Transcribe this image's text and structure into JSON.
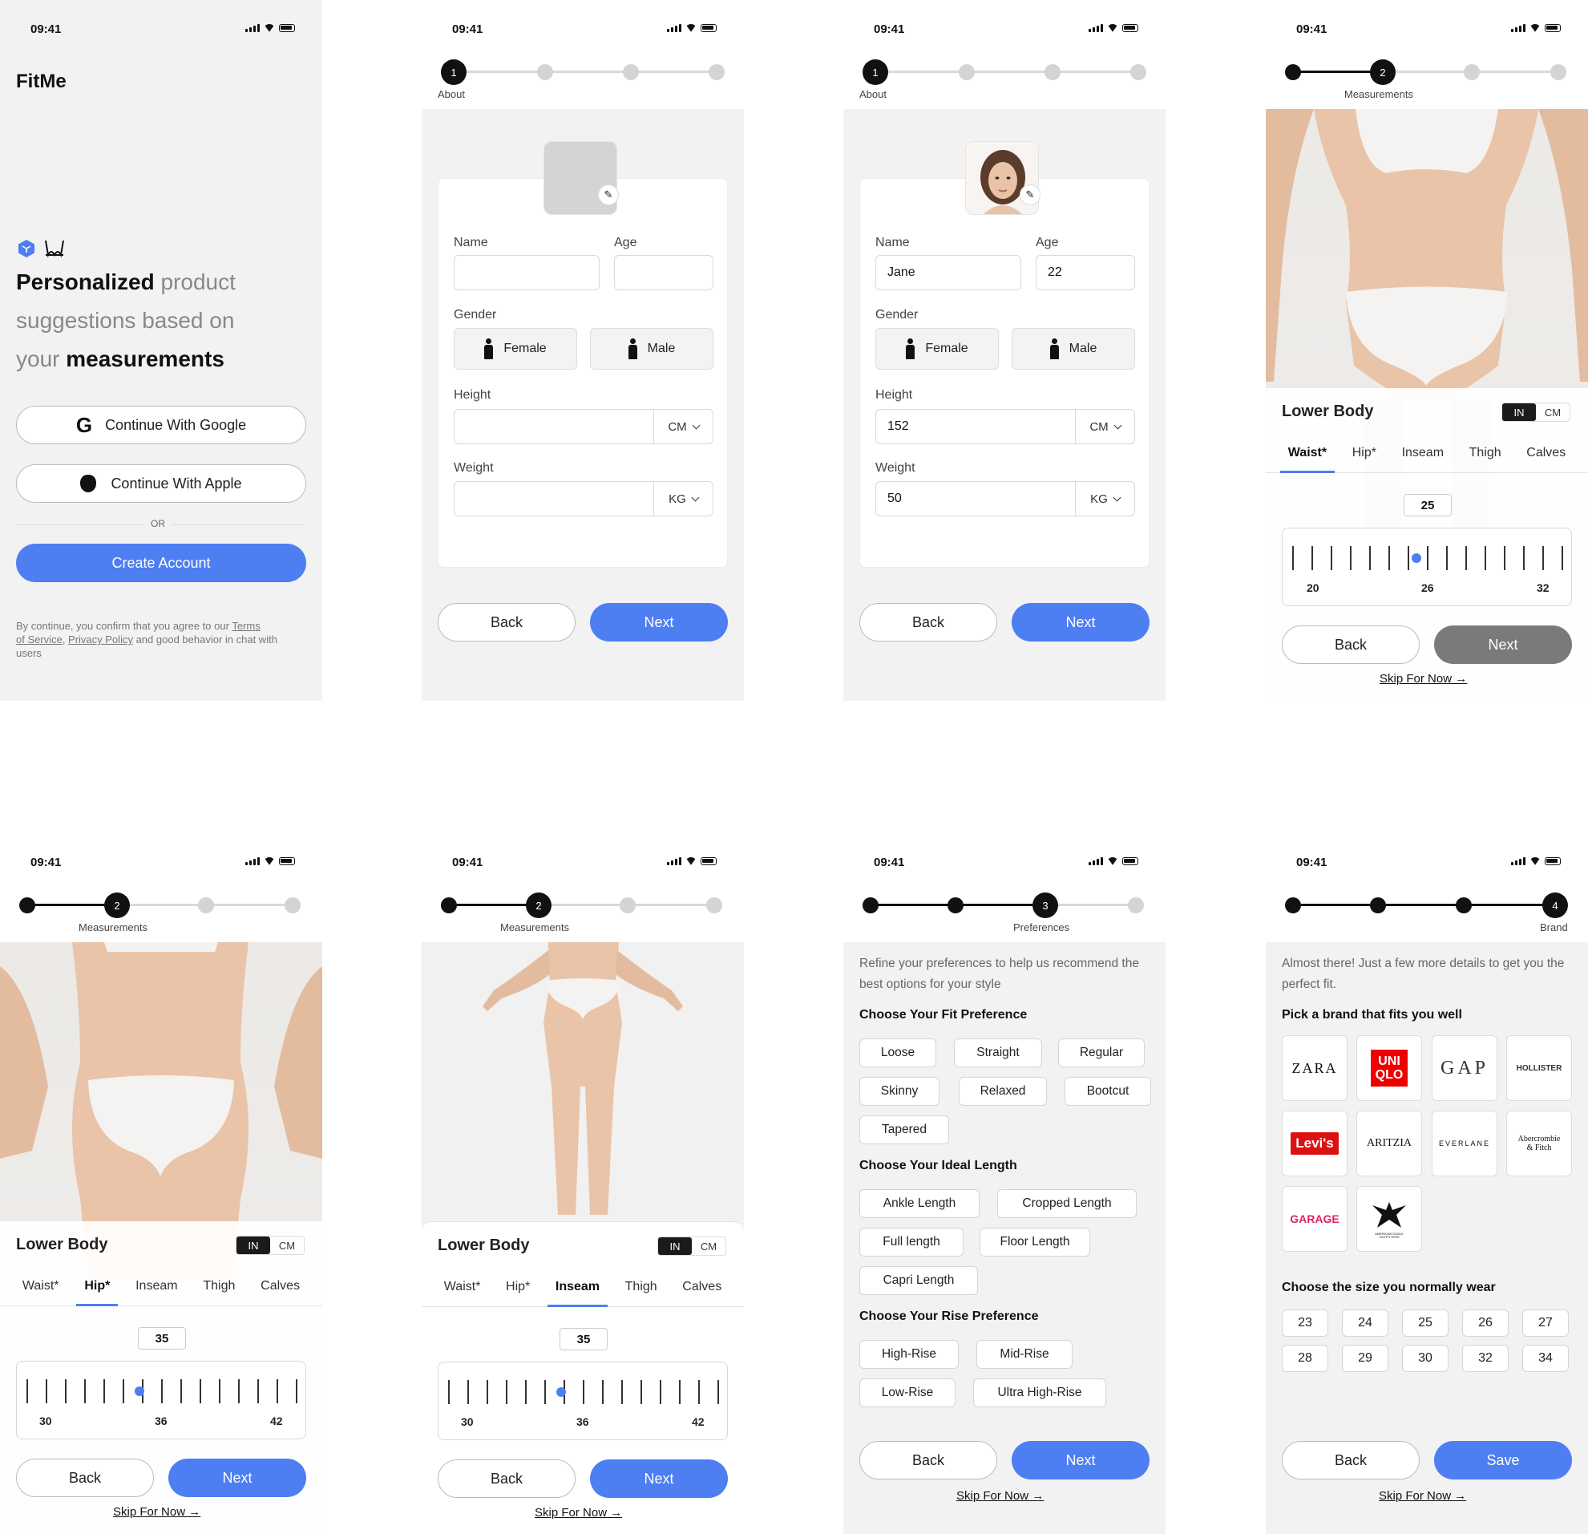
{
  "status_time": "09:41",
  "s1": {
    "app_name": "FitMe",
    "headline_a": "Personalized",
    "headline_b": " product",
    "headline_c": "suggestions based on",
    "headline_d": "your ",
    "headline_e": "measurements",
    "google_label": "Continue With Google",
    "apple_label": "Continue With Apple",
    "or_label": "OR",
    "create_label": "Create Account",
    "legal_a": "By continue, you confirm that you agree to our ",
    "legal_terms_1": "Terms",
    "legal_terms_2": "of Service",
    "legal_b": ", ",
    "legal_privacy": "Privacy Policy",
    "legal_c": " and good behavior in chat with users"
  },
  "about": {
    "step_label": "About",
    "step_num": "1",
    "name_label": "Name",
    "age_label": "Age",
    "gender_label": "Gender",
    "female_label": "Female",
    "male_label": "Male",
    "height_label": "Height",
    "weight_label": "Weight",
    "height_unit": "CM",
    "weight_unit": "KG",
    "filled": {
      "name": "Jane",
      "age": "22",
      "height": "152",
      "weight": "50"
    }
  },
  "buttons": {
    "back": "Back",
    "next": "Next",
    "save": "Save",
    "skip": "Skip For Now →"
  },
  "measure": {
    "step_label": "Measurements",
    "step_num": "2",
    "title": "Lower Body",
    "unit_in": "IN",
    "unit_cm": "CM",
    "tabs": [
      "Waist*",
      "Hip*",
      "Inseam",
      "Thigh",
      "Calves"
    ],
    "waist": {
      "value": "25",
      "min": "20",
      "mid": "26",
      "max": "32",
      "selected_fraction": 0.46
    },
    "hip": {
      "value": "35",
      "min": "30",
      "mid": "36",
      "max": "42",
      "selected_fraction": 0.42
    },
    "inseam": {
      "value": "35",
      "min": "30",
      "mid": "36",
      "max": "42",
      "selected_fraction": 0.42
    }
  },
  "prefs": {
    "step_label": "Preferences",
    "step_num": "3",
    "intro": "Refine your preferences to help us recommend the best options for your style",
    "fit_heading": "Choose Your Fit Preference",
    "fit": [
      "Loose",
      "Straight",
      "Regular",
      "Skinny",
      "Relaxed",
      "Bootcut",
      "Tapered"
    ],
    "length_heading": "Choose Your Ideal Length",
    "length": [
      "Ankle Length",
      "Cropped Length",
      "Full length",
      "Floor Length",
      "Capri Length"
    ],
    "rise_heading": "Choose Your Rise Preference",
    "rise": [
      "High-Rise",
      "Mid-Rise",
      "Low-Rise",
      "Ultra High-Rise"
    ]
  },
  "brand": {
    "step_label": "Brand",
    "step_num": "4",
    "intro": "Almost there! Just a few more details to get you the perfect fit.",
    "brand_heading": "Pick a brand that fits you well",
    "brands": [
      "ZARA",
      "UNI QLO",
      "GAP",
      "HOLLISTER",
      "Levi's",
      "ARITZIA",
      "EVERLANE",
      "Abercrombie & Fitch",
      "GARAGE",
      "AMERICAN EAGLE OUTFITTERS"
    ],
    "size_heading": "Choose the size you normally wear",
    "sizes": [
      "23",
      "24",
      "25",
      "26",
      "27",
      "28",
      "29",
      "30",
      "32",
      "34"
    ]
  }
}
